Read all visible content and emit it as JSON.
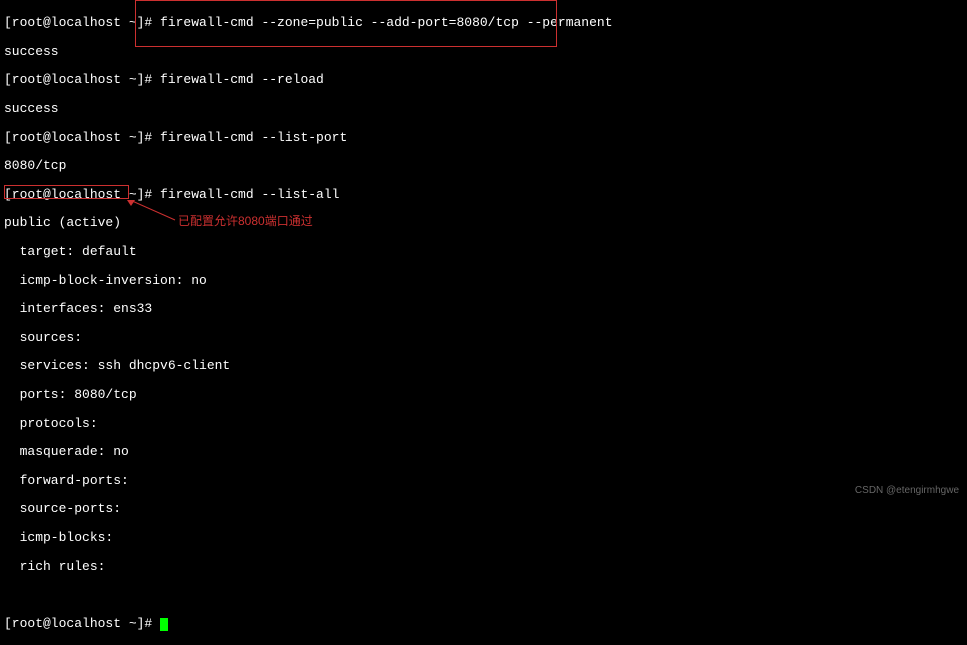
{
  "prompt": "[root@localhost ~]# ",
  "lines": {
    "cmd1": "firewall-cmd --zone=public --add-port=8080/tcp --permanent",
    "out1": "success",
    "cmd2": "firewall-cmd --reload",
    "out2": "success",
    "cmd3": "firewall-cmd --list-port",
    "out3": "8080/tcp",
    "cmd4": "firewall-cmd --list-all",
    "listall": {
      "l1": "public (active)",
      "l2": "  target: default",
      "l3": "  icmp-block-inversion: no",
      "l4": "  interfaces: ens33",
      "l5": "  sources: ",
      "l6": "  services: ssh dhcpv6-client",
      "l7": "  ports: 8080/tcp",
      "l8": "  protocols: ",
      "l9": "  masquerade: no",
      "l10": "  forward-ports: ",
      "l11": "  source-ports: ",
      "l12": "  icmp-blocks: ",
      "l13": "  rich rules: ",
      "l14": "\t"
    }
  },
  "annotation": "已配置允许8080端口通过",
  "watermark": "CSDN @etengirmhgwe"
}
